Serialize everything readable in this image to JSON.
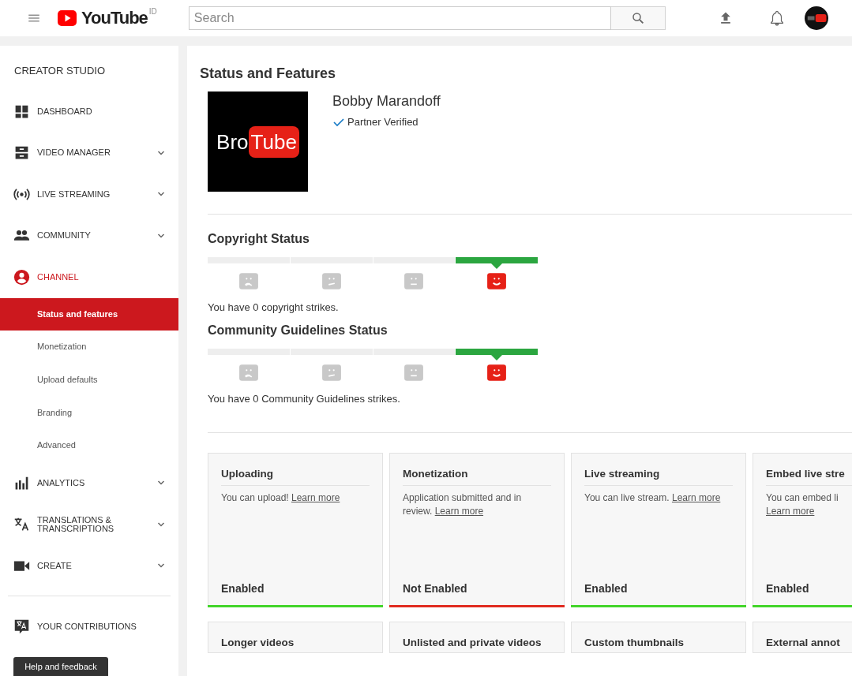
{
  "header": {
    "logo_text": "YouTube",
    "region": "ID",
    "search": {
      "placeholder": "Search"
    }
  },
  "sidebar": {
    "title": "CREATOR STUDIO",
    "items": [
      {
        "kind": "section",
        "label": "DASHBOARD",
        "expandable": false,
        "active": false
      },
      {
        "kind": "section",
        "label": "VIDEO MANAGER",
        "expandable": true,
        "active": false
      },
      {
        "kind": "section",
        "label": "LIVE STREAMING",
        "expandable": true,
        "active": false
      },
      {
        "kind": "section",
        "label": "COMMUNITY",
        "expandable": true,
        "active": false
      },
      {
        "kind": "section",
        "label": "CHANNEL",
        "expandable": false,
        "active": true
      },
      {
        "kind": "sub",
        "label": "Status and features",
        "selected": true
      },
      {
        "kind": "sub",
        "label": "Monetization",
        "selected": false
      },
      {
        "kind": "sub",
        "label": "Upload defaults",
        "selected": false
      },
      {
        "kind": "sub",
        "label": "Branding",
        "selected": false
      },
      {
        "kind": "sub",
        "label": "Advanced",
        "selected": false
      },
      {
        "kind": "section",
        "label": "ANALYTICS",
        "expandable": true,
        "active": false
      },
      {
        "kind": "section",
        "label": "TRANSLATIONS & TRANSCRIPTIONS",
        "expandable": true,
        "active": false
      },
      {
        "kind": "section",
        "label": "CREATE",
        "expandable": true,
        "active": false
      },
      {
        "kind": "divider"
      },
      {
        "kind": "section",
        "label": "YOUR CONTRIBUTIONS",
        "expandable": false,
        "active": false
      }
    ],
    "help_button": "Help and feedback"
  },
  "main": {
    "title": "Status and Features",
    "channel": {
      "logo_left": "Bro",
      "logo_right": "Tube",
      "name": "Bobby Marandoff",
      "badge": "Partner Verified"
    },
    "statuses": [
      {
        "title": "Copyright Status",
        "levels": [
          {
            "selected": false
          },
          {
            "selected": false
          },
          {
            "selected": false
          },
          {
            "selected": true
          }
        ],
        "message": "You have 0 copyright strikes."
      },
      {
        "title": "Community Guidelines Status",
        "levels": [
          {
            "selected": false
          },
          {
            "selected": false
          },
          {
            "selected": false
          },
          {
            "selected": true
          }
        ],
        "message": "You have 0 Community Guidelines strikes."
      }
    ],
    "features": [
      {
        "title": "Uploading",
        "text": "You can upload!",
        "link": "Learn more",
        "status": "Enabled",
        "enabled": true
      },
      {
        "title": "Monetization",
        "text": "Application submitted and in review.",
        "link": "Learn more",
        "status": "Not Enabled",
        "enabled": false
      },
      {
        "title": "Live streaming",
        "text": "You can live stream.",
        "link": "Learn more",
        "status": "Enabled",
        "enabled": true
      },
      {
        "title": "Embed live stre",
        "text": "You can embed li",
        "link": "Learn more",
        "status": "Enabled",
        "enabled": true
      },
      {
        "title": "Longer videos"
      },
      {
        "title": "Unlisted and private videos"
      },
      {
        "title": "Custom thumbnails"
      },
      {
        "title": "External annot"
      }
    ]
  }
}
